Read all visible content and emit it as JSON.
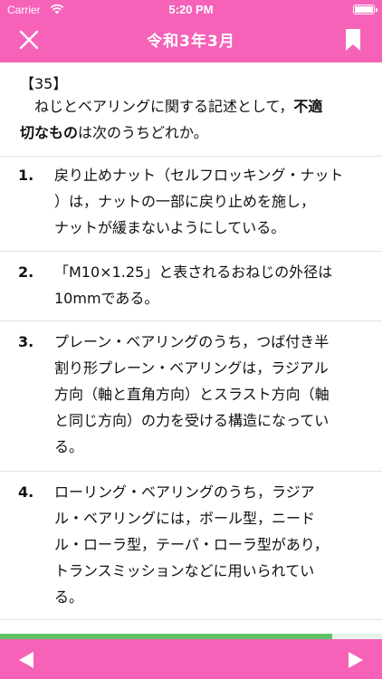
{
  "status_bar": {
    "carrier": "Carrier",
    "time": "5:20 PM"
  },
  "nav": {
    "title": "令和3年3月",
    "close_icon": "close-icon",
    "bookmark_icon": "bookmark-icon"
  },
  "question": {
    "number": "【35】",
    "text_before": "ねじとベアリングに関する記述として，",
    "text_bold_1": "不適",
    "text_bold_2": "切なもの",
    "text_after": "は次のうちどれか。"
  },
  "options": [
    {
      "num": "1.",
      "lines": [
        "戻り止めナット（セルフロッキング・ナット",
        "）は，ナットの一部に戻り止めを施し，",
        "ナットが緩まないようにしている。"
      ]
    },
    {
      "num": "2.",
      "lines": [
        "「M10×1.25」と表されるおねじの外径は",
        "10mmである。"
      ]
    },
    {
      "num": "3.",
      "lines": [
        "プレーン・ベアリングのうち，つば付き半",
        "割り形プレーン・ベアリングは，ラジアル",
        "方向（軸と直角方向）とスラスト方向（軸",
        "と同じ方向）の力を受ける構造になってい",
        "る。"
      ]
    },
    {
      "num": "4.",
      "lines": [
        "ローリング・ベアリングのうち，ラジア",
        "ル・ベアリングには，ボール型，ニード",
        "ル・ローラ型，テーパ・ローラ型があり，",
        "トランスミッションなどに用いられてい",
        "る。"
      ]
    }
  ],
  "progress": {
    "fraction": 0.87
  },
  "colors": {
    "accent": "#f562b8",
    "progress": "#5ec463"
  },
  "footer": {
    "prev_icon": "triangle-left-icon",
    "next_icon": "triangle-right-icon"
  }
}
